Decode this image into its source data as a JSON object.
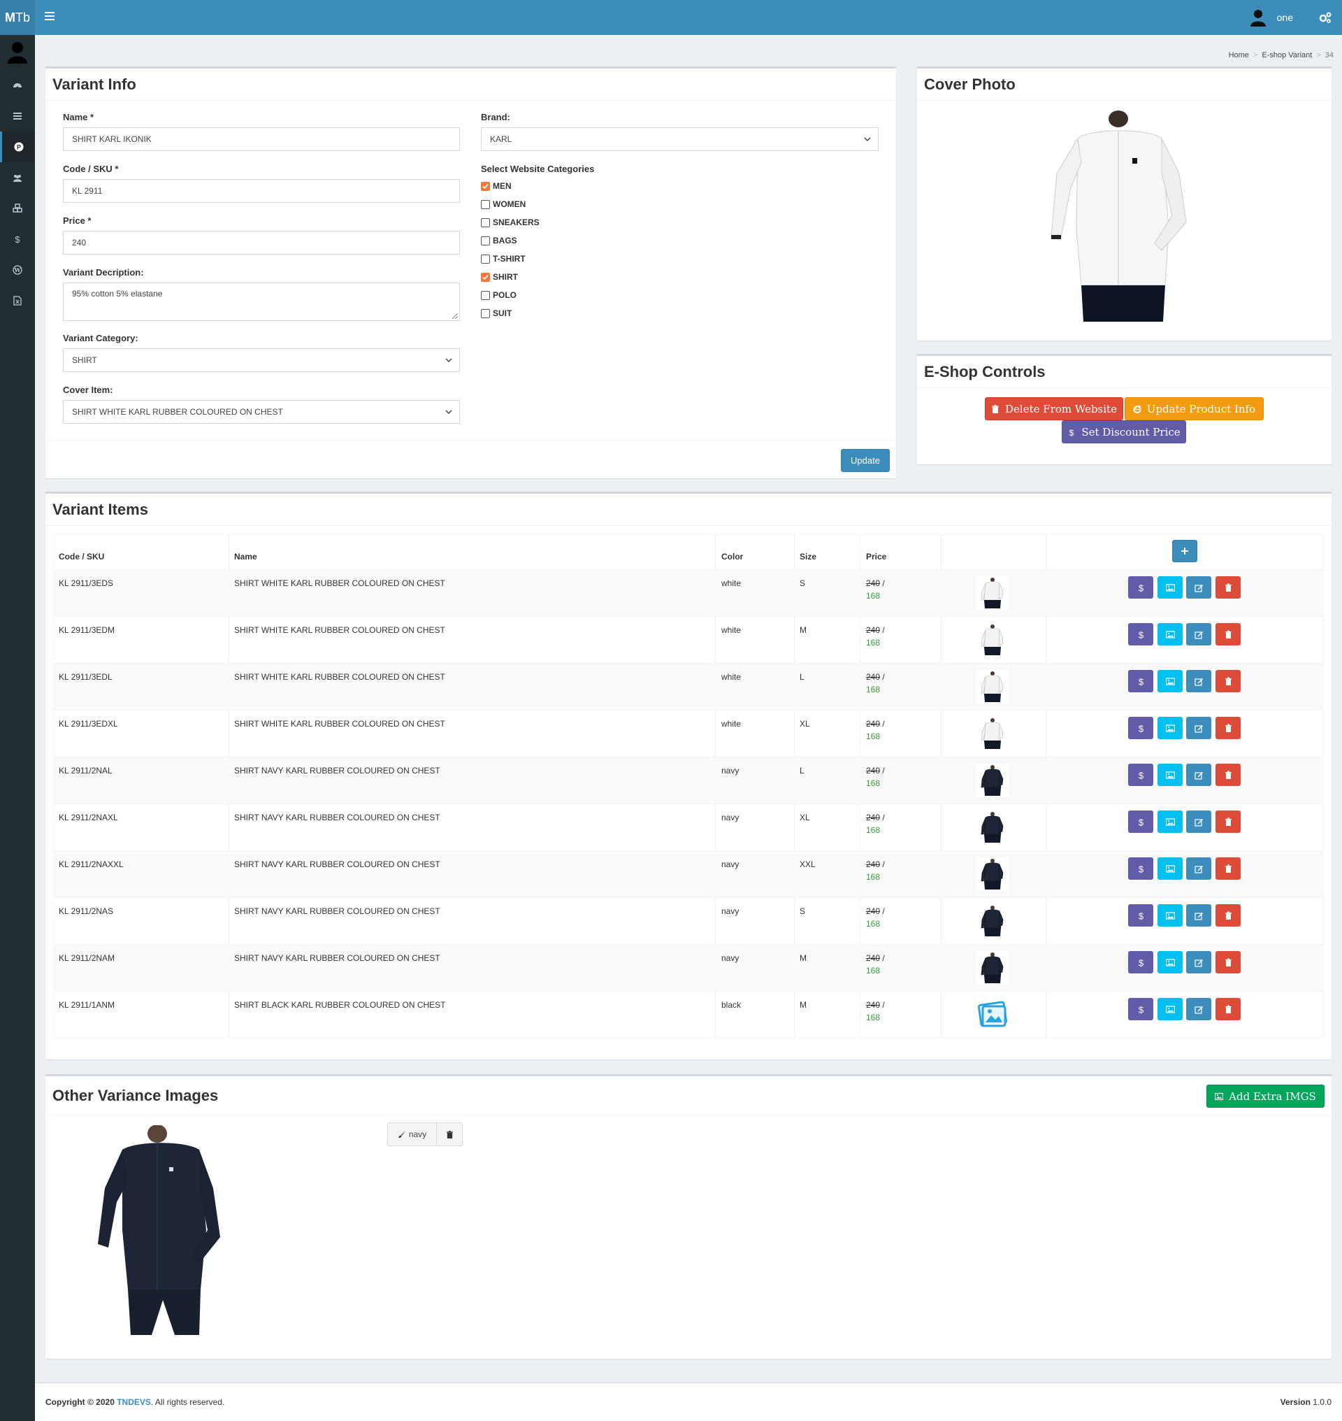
{
  "header": {
    "logo_bold": "M",
    "logo_rest": "Tb",
    "username": "one"
  },
  "sidebar": {
    "items": [
      {
        "icon": "dashboard-icon"
      },
      {
        "icon": "list-icon"
      },
      {
        "icon": "product-icon"
      },
      {
        "icon": "users-icon"
      },
      {
        "icon": "cubes-icon"
      },
      {
        "icon": "dollar-icon"
      },
      {
        "icon": "wordpress-icon"
      },
      {
        "icon": "excel-icon"
      }
    ]
  },
  "breadcrumb": {
    "home": "Home",
    "section": "E-shop Variant",
    "current": "34"
  },
  "variant_info": {
    "title": "Variant Info",
    "name_label": "Name *",
    "name_value": "SHIRT KARL IKONIK",
    "code_label": "Code / SKU *",
    "code_value": "KL 2911",
    "price_label": "Price *",
    "price_value": "240",
    "desc_label": "Variant Decription:",
    "desc_value": "95% cotton 5% elastane",
    "category_label": "Variant Category:",
    "category_value": "SHIRT",
    "cover_label": "Cover Item:",
    "cover_value": "SHIRT WHITE KARL RUBBER COLOURED ON CHEST",
    "brand_label": "Brand:",
    "brand_value": "KARL",
    "categories_label": "Select Website Categories",
    "categories": [
      {
        "label": "MEN",
        "checked": true
      },
      {
        "label": "WOMEN",
        "checked": false
      },
      {
        "label": "SNEAKERS",
        "checked": false
      },
      {
        "label": "BAGS",
        "checked": false
      },
      {
        "label": "T-SHIRT",
        "checked": false
      },
      {
        "label": "SHIRT",
        "checked": true
      },
      {
        "label": "POLO",
        "checked": false
      },
      {
        "label": "SUIT",
        "checked": false
      }
    ],
    "update_label": "Update"
  },
  "cover_photo": {
    "title": "Cover Photo"
  },
  "eshop_controls": {
    "title": "E-Shop Controls",
    "delete_label": "Delete From Website",
    "update_label": "Update Product Info",
    "discount_label": "Set Discount Price"
  },
  "variant_items": {
    "title": "Variant Items",
    "columns": [
      "Code / SKU",
      "Name",
      "Color",
      "Size",
      "Price"
    ],
    "rows": [
      {
        "code": "KL 2911/3EDS",
        "name": "SHIRT WHITE KARL RUBBER COLOURED ON CHEST",
        "color": "white",
        "size": "S",
        "price": "240",
        "sep": "/",
        "discount": "168",
        "thumb": "white"
      },
      {
        "code": "KL 2911/3EDM",
        "name": "SHIRT WHITE KARL RUBBER COLOURED ON CHEST",
        "color": "white",
        "size": "M",
        "price": "240",
        "sep": "/",
        "discount": "168",
        "thumb": "white"
      },
      {
        "code": "KL 2911/3EDL",
        "name": "SHIRT WHITE KARL RUBBER COLOURED ON CHEST",
        "color": "white",
        "size": "L",
        "price": "240",
        "sep": "/",
        "discount": "168",
        "thumb": "white"
      },
      {
        "code": "KL 2911/3EDXL",
        "name": "SHIRT WHITE KARL RUBBER COLOURED ON CHEST",
        "color": "white",
        "size": "XL",
        "price": "240",
        "sep": "/",
        "discount": "168",
        "thumb": "white"
      },
      {
        "code": "KL 2911/2NAL",
        "name": "SHIRT NAVY KARL RUBBER COLOURED ON CHEST",
        "color": "navy",
        "size": "L",
        "price": "240",
        "sep": "/",
        "discount": "168",
        "thumb": "navy"
      },
      {
        "code": "KL 2911/2NAXL",
        "name": "SHIRT NAVY KARL RUBBER COLOURED ON CHEST",
        "color": "navy",
        "size": "XL",
        "price": "240",
        "sep": "/",
        "discount": "168",
        "thumb": "navy"
      },
      {
        "code": "KL 2911/2NAXXL",
        "name": "SHIRT NAVY KARL RUBBER COLOURED ON CHEST",
        "color": "navy",
        "size": "XXL",
        "price": "240",
        "sep": "/",
        "discount": "168",
        "thumb": "navy"
      },
      {
        "code": "KL 2911/2NAS",
        "name": "SHIRT NAVY KARL RUBBER COLOURED ON CHEST",
        "color": "navy",
        "size": "S",
        "price": "240",
        "sep": "/",
        "discount": "168",
        "thumb": "navy"
      },
      {
        "code": "KL 2911/2NAM",
        "name": "SHIRT NAVY KARL RUBBER COLOURED ON CHEST",
        "color": "navy",
        "size": "M",
        "price": "240",
        "sep": "/",
        "discount": "168",
        "thumb": "navy"
      },
      {
        "code": "KL 2911/1ANM",
        "name": "SHIRT BLACK KARL RUBBER COLOURED ON CHEST",
        "color": "black",
        "size": "M",
        "price": "240",
        "sep": "/",
        "discount": "168",
        "thumb": "placeholder"
      }
    ]
  },
  "other_images": {
    "title": "Other Variance Images",
    "add_label": "Add Extra IMGS",
    "tag_label": "navy"
  },
  "footer": {
    "copyright": "Copyright © 2020",
    "company": "TNDEVS",
    "rights": ". All rights reserved.",
    "version_label": "Version",
    "version_value": "1.0.0"
  },
  "colors": {
    "header": "#3c8dbc",
    "sidebar": "#222d32",
    "danger": "#dd4b39",
    "warning": "#f39c12",
    "purple": "#605ca8",
    "info": "#00c0ef",
    "success": "#00a65a",
    "checked": "#f0793b"
  }
}
